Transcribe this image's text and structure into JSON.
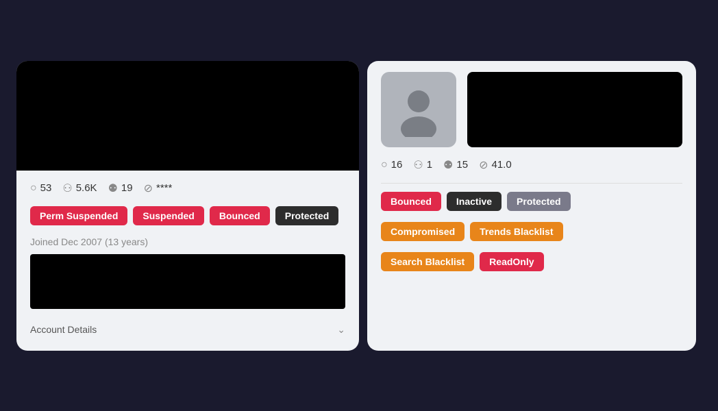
{
  "left_card": {
    "stats": [
      {
        "icon": "○",
        "value": "53",
        "name": "comments"
      },
      {
        "icon": "⚇",
        "value": "5.6K",
        "name": "followers"
      },
      {
        "icon": "⚉",
        "value": "19",
        "name": "following"
      },
      {
        "icon": "⊘",
        "value": "****",
        "name": "extra"
      }
    ],
    "tags": [
      {
        "label": "Perm Suspended",
        "style": "tag-red",
        "name": "perm-suspended-tag"
      },
      {
        "label": "Suspended",
        "style": "tag-red",
        "name": "suspended-tag"
      },
      {
        "label": "Bounced",
        "style": "tag-red",
        "name": "bounced-tag"
      },
      {
        "label": "Protected",
        "style": "tag-dark",
        "name": "protected-tag"
      }
    ],
    "joined": "Joined Dec 2007 (13 years)",
    "account_details": "Account Details"
  },
  "right_card": {
    "stats": [
      {
        "icon": "○",
        "value": "16",
        "name": "comments"
      },
      {
        "icon": "⚇",
        "value": "1",
        "name": "followers"
      },
      {
        "icon": "⚉",
        "value": "15",
        "name": "following"
      },
      {
        "icon": "⊘",
        "value": "41.0",
        "name": "extra"
      }
    ],
    "tags_row1": [
      {
        "label": "Bounced",
        "style": "tag-red",
        "name": "right-bounced-tag"
      },
      {
        "label": "Inactive",
        "style": "tag-dark",
        "name": "right-inactive-tag"
      },
      {
        "label": "Protected",
        "style": "tag-gray",
        "name": "right-protected-tag"
      }
    ],
    "tags_row2": [
      {
        "label": "Compromised",
        "style": "tag-orange",
        "name": "compromised-tag"
      },
      {
        "label": "Trends Blacklist",
        "style": "tag-orange",
        "name": "trends-blacklist-tag"
      }
    ],
    "tags_row3": [
      {
        "label": "Search Blacklist",
        "style": "tag-orange",
        "name": "search-blacklist-tag"
      },
      {
        "label": "ReadOnly",
        "style": "tag-pink",
        "name": "readonly-tag"
      }
    ]
  }
}
